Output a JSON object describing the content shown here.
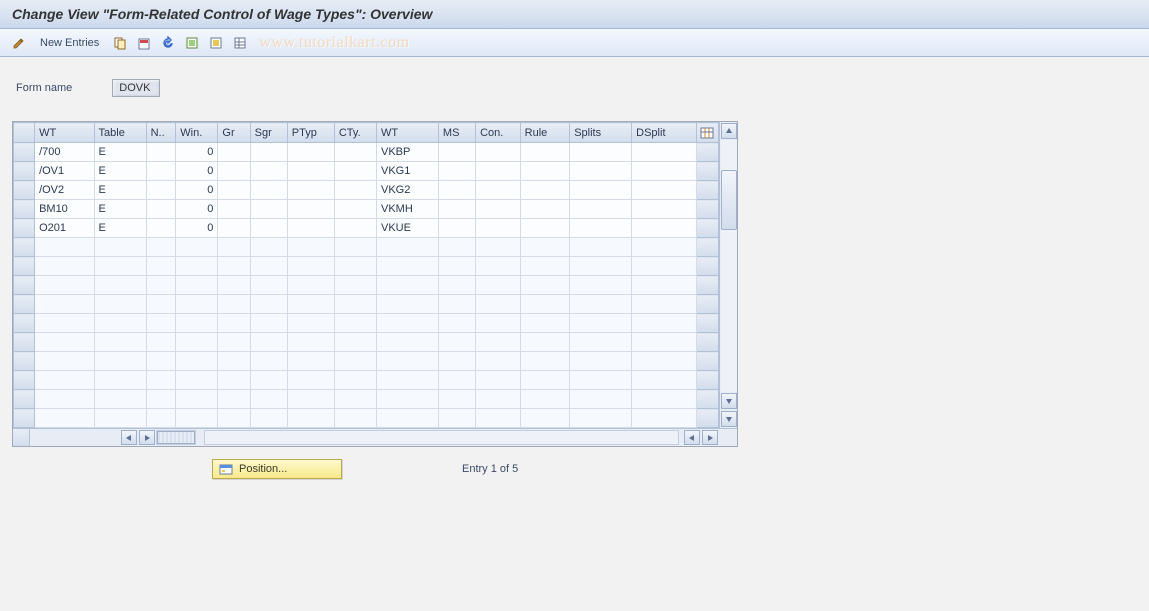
{
  "title": "Change View \"Form-Related Control of Wage Types\": Overview",
  "toolbar": {
    "new_entries": "New Entries"
  },
  "watermark": "www.tutorialkart.com",
  "form": {
    "name_label": "Form name",
    "name_value": "DOVK"
  },
  "grid": {
    "columns": [
      "WT",
      "Table",
      "N..",
      "Win.",
      "Gr",
      "Sgr",
      "PTyp",
      "CTy.",
      "WT",
      "MS",
      "Con.",
      "Rule",
      "Splits",
      "DSplit"
    ],
    "rows": [
      {
        "c0": "/700",
        "c1": "E",
        "c2": "",
        "c3": "0",
        "c4": "",
        "c5": "",
        "c6": "",
        "c7": "",
        "c8": "VKBP",
        "c9": "",
        "c10": "",
        "c11": "",
        "c12": "",
        "c13": ""
      },
      {
        "c0": "/OV1",
        "c1": "E",
        "c2": "",
        "c3": "0",
        "c4": "",
        "c5": "",
        "c6": "",
        "c7": "",
        "c8": "VKG1",
        "c9": "",
        "c10": "",
        "c11": "",
        "c12": "",
        "c13": ""
      },
      {
        "c0": "/OV2",
        "c1": "E",
        "c2": "",
        "c3": "0",
        "c4": "",
        "c5": "",
        "c6": "",
        "c7": "",
        "c8": "VKG2",
        "c9": "",
        "c10": "",
        "c11": "",
        "c12": "",
        "c13": ""
      },
      {
        "c0": "BM10",
        "c1": "E",
        "c2": "",
        "c3": "0",
        "c4": "",
        "c5": "",
        "c6": "",
        "c7": "",
        "c8": "VKMH",
        "c9": "",
        "c10": "",
        "c11": "",
        "c12": "",
        "c13": ""
      },
      {
        "c0": "O201",
        "c1": "E",
        "c2": "",
        "c3": "0",
        "c4": "",
        "c5": "",
        "c6": "",
        "c7": "",
        "c8": "VKUE",
        "c9": "",
        "c10": "",
        "c11": "",
        "c12": "",
        "c13": ""
      }
    ],
    "blank_row_count": 10
  },
  "footer": {
    "position_label": "Position...",
    "entry_status": "Entry 1 of 5"
  },
  "colors": {
    "header_grad_top": "#e8edf5",
    "header_grad_bottom": "#cbd9ed",
    "accent_yellow": "#f7e98a"
  }
}
